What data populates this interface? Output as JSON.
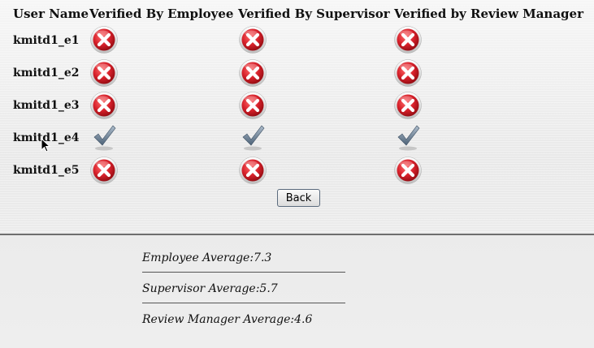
{
  "table": {
    "headers": [
      "User Name",
      "Verified By Employee",
      "Verified By Supervisor",
      "Verified by Review Manager"
    ],
    "rows": [
      {
        "user": "kmitd1_e1",
        "employee": "cross-icon",
        "supervisor": "cross-icon",
        "review_manager": "cross-icon"
      },
      {
        "user": "kmitd1_e2",
        "employee": "cross-icon",
        "supervisor": "cross-icon",
        "review_manager": "cross-icon"
      },
      {
        "user": "kmitd1_e3",
        "employee": "cross-icon",
        "supervisor": "cross-icon",
        "review_manager": "cross-icon"
      },
      {
        "user": "kmitd1_e4",
        "employee": "check-icon",
        "supervisor": "check-icon",
        "review_manager": "check-icon"
      },
      {
        "user": "kmitd1_e5",
        "employee": "cross-icon",
        "supervisor": "cross-icon",
        "review_manager": "cross-icon"
      }
    ]
  },
  "actions": {
    "back_label": "Back"
  },
  "averages": {
    "employee": "Employee Average:7.3",
    "supervisor": "Supervisor Average:5.7",
    "review_manager": "Review Manager Average:4.6"
  },
  "colors": {
    "cross": "#d6202a",
    "check": "#6f8599",
    "divider": "#6e6e6e"
  }
}
